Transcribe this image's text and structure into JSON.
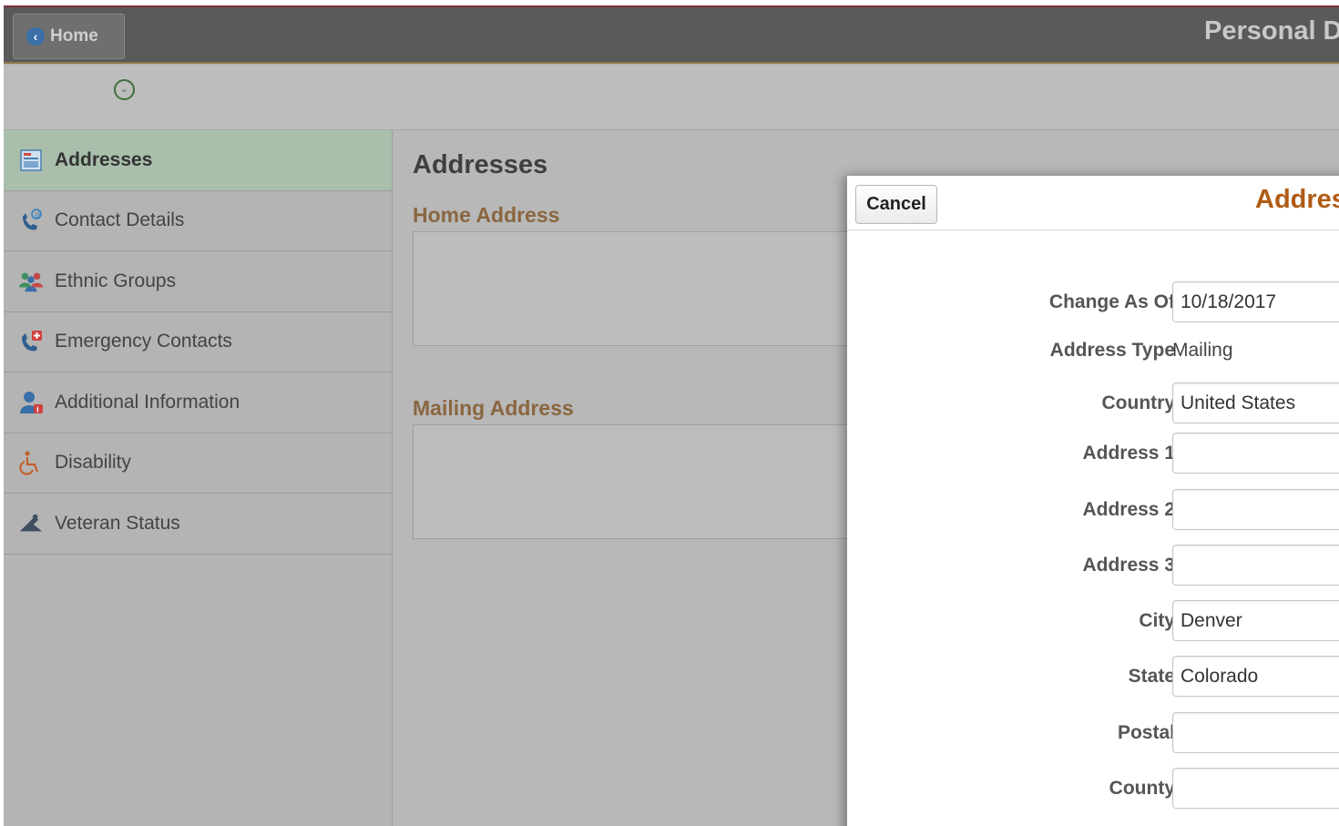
{
  "header": {
    "home_label": "Home",
    "page_title": "Personal D"
  },
  "sidebar": {
    "items": [
      {
        "label": "Addresses",
        "icon": "address-card-icon",
        "active": true
      },
      {
        "label": "Contact Details",
        "icon": "phone-email-icon",
        "active": false
      },
      {
        "label": "Ethnic Groups",
        "icon": "people-group-icon",
        "active": false
      },
      {
        "label": "Emergency Contacts",
        "icon": "phone-emergency-icon",
        "active": false
      },
      {
        "label": "Additional Information",
        "icon": "person-info-icon",
        "active": false
      },
      {
        "label": "Disability",
        "icon": "wheelchair-icon",
        "active": false
      },
      {
        "label": "Veteran Status",
        "icon": "veteran-salute-icon",
        "active": false
      }
    ]
  },
  "main": {
    "heading": "Addresses",
    "home_section": "Home Address",
    "mailing_section": "Mailing Address"
  },
  "modal": {
    "cancel_label": "Cancel",
    "title": "Addres",
    "fields": {
      "change_as_of": {
        "label": "Change As Of",
        "value": "10/18/2017"
      },
      "address_type": {
        "label": "Address Type",
        "value": "Mailing"
      },
      "country": {
        "label": "Country",
        "value": "United States"
      },
      "address1": {
        "label": "Address 1",
        "value": ""
      },
      "address2": {
        "label": "Address 2",
        "value": ""
      },
      "address3": {
        "label": "Address 3",
        "value": ""
      },
      "city": {
        "label": "City",
        "value": "Denver"
      },
      "state": {
        "label": "State",
        "value": "Colorado"
      },
      "postal": {
        "label": "Postal",
        "value": ""
      },
      "county": {
        "label": "County",
        "value": ""
      }
    }
  },
  "colors": {
    "banner": "#5a5a5a",
    "active_item": "#a9bfac",
    "section_title": "#8a6640",
    "modal_title": "#b05b15"
  }
}
